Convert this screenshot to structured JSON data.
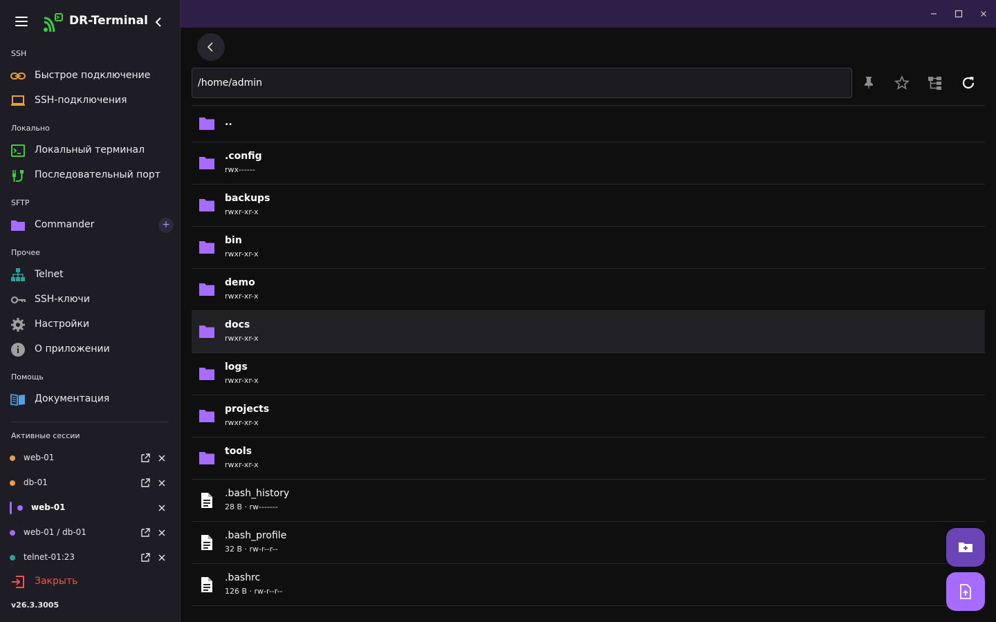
{
  "app": {
    "title": "DR-Terminal",
    "version": "v26.3.3005"
  },
  "sidebar": {
    "sections": {
      "ssh": "SSH",
      "local": "Локально",
      "sftp": "SFTP",
      "other": "Прочее",
      "help": "Помощь",
      "sessions": "Активные сессии"
    },
    "items": {
      "quick_connect": "Быстрое подключение",
      "ssh_connections": "SSH-подключения",
      "local_terminal": "Локальный терминал",
      "serial_port": "Последовательный порт",
      "commander": "Commander",
      "telnet": "Telnet",
      "ssh_keys": "SSH-ключи",
      "settings": "Настройки",
      "about": "О приложении",
      "docs": "Документация"
    },
    "add_symbol": "+",
    "close_label": "Закрыть",
    "sessions": [
      {
        "label": "web-01",
        "color": "#f0a030",
        "active": false,
        "detachable": true
      },
      {
        "label": "db-01",
        "color": "#f0a030",
        "active": false,
        "detachable": true
      },
      {
        "label": "web-01",
        "color": "#a16bff",
        "active": true,
        "detachable": false
      },
      {
        "label": "web-01 / db-01",
        "color": "#a16bff",
        "active": false,
        "detachable": true
      },
      {
        "label": "telnet-01:23",
        "color": "#26a69a",
        "active": false,
        "detachable": true
      }
    ]
  },
  "colors": {
    "accent": "#a16bff",
    "folder": "#a66cff",
    "danger": "#f0544f",
    "titlebar": "#2d1f47"
  },
  "browser": {
    "path": "/home/admin",
    "entries": [
      {
        "name": "..",
        "meta": "",
        "type": "folder"
      },
      {
        "name": ".config",
        "meta": "rwx------",
        "type": "folder"
      },
      {
        "name": "backups",
        "meta": "rwxr-xr-x",
        "type": "folder"
      },
      {
        "name": "bin",
        "meta": "rwxr-xr-x",
        "type": "folder"
      },
      {
        "name": "demo",
        "meta": "rwxr-xr-x",
        "type": "folder"
      },
      {
        "name": "docs",
        "meta": "rwxr-xr-x",
        "type": "folder",
        "highlight": true
      },
      {
        "name": "logs",
        "meta": "rwxr-xr-x",
        "type": "folder"
      },
      {
        "name": "projects",
        "meta": "rwxr-xr-x",
        "type": "folder"
      },
      {
        "name": "tools",
        "meta": "rwxr-xr-x",
        "type": "folder"
      },
      {
        "name": ".bash_history",
        "meta": "28 B · rw-------",
        "type": "file"
      },
      {
        "name": ".bash_profile",
        "meta": "32 B · rw-r--r--",
        "type": "file"
      },
      {
        "name": ".bashrc",
        "meta": "126 B · rw-r--r--",
        "type": "file"
      }
    ]
  }
}
